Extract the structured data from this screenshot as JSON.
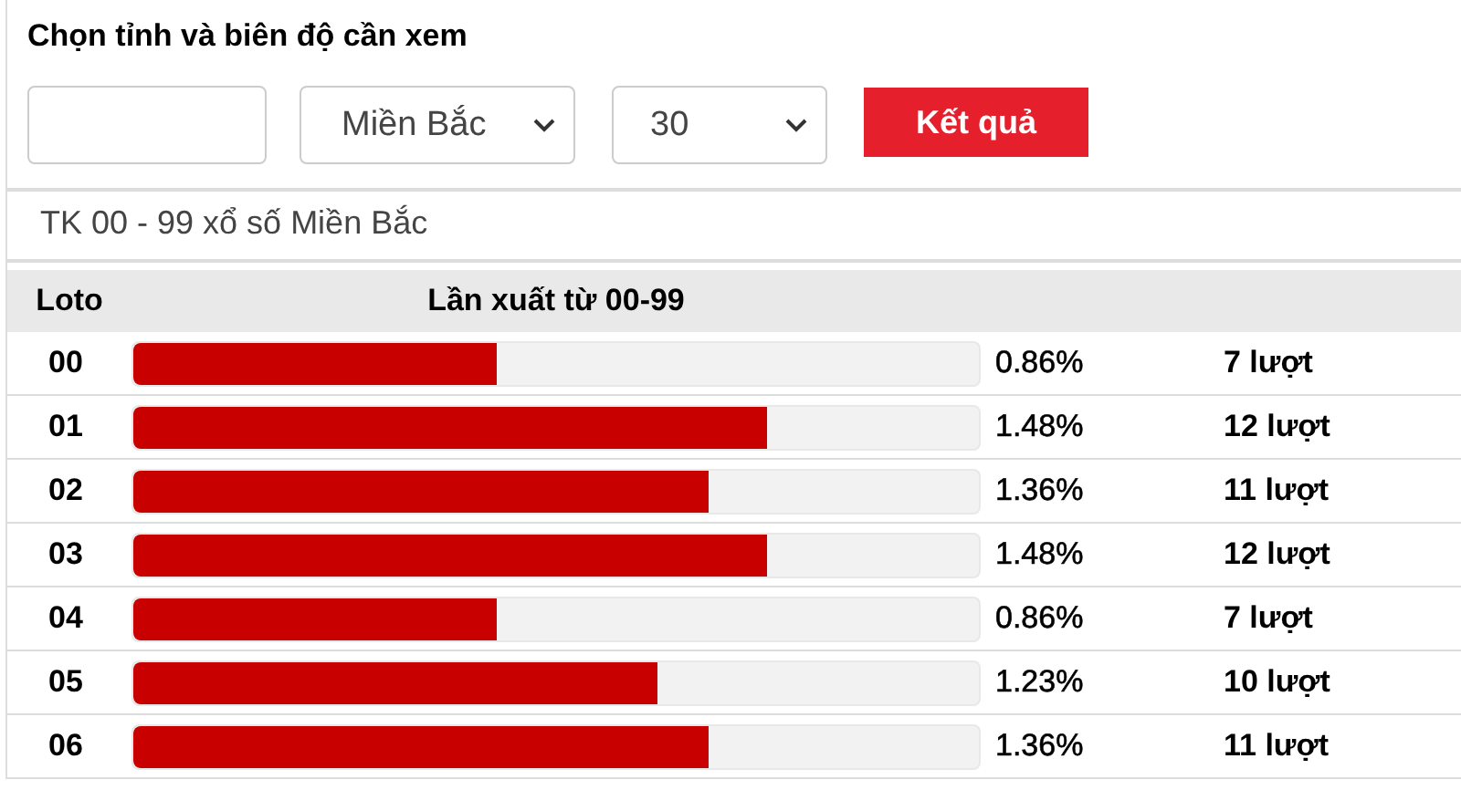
{
  "heading": "Chọn tỉnh và biên độ cần xem",
  "filters": {
    "region": "Miền Bắc",
    "days": "30",
    "button": "Kết quả"
  },
  "subtitle": "TK 00 - 99 xổ số Miền Bắc",
  "table": {
    "columns": [
      "Loto",
      "Lần xuất từ 00-99"
    ],
    "rows": [
      {
        "number": "00",
        "level": 0.43,
        "percent": "0.86%",
        "count": "7 lượt"
      },
      {
        "number": "01",
        "level": 0.75,
        "percent": "1.48%",
        "count": "12 lượt"
      },
      {
        "number": "02",
        "level": 0.68,
        "percent": "1.36%",
        "count": "11 lượt"
      },
      {
        "number": "03",
        "level": 0.75,
        "percent": "1.48%",
        "count": "12 lượt"
      },
      {
        "number": "04",
        "level": 0.43,
        "percent": "0.86%",
        "count": "7 lượt"
      },
      {
        "number": "05",
        "level": 0.62,
        "percent": "1.23%",
        "count": "10 lượt"
      },
      {
        "number": "06",
        "level": 0.68,
        "percent": "1.36%",
        "count": "11 lượt"
      }
    ]
  }
}
